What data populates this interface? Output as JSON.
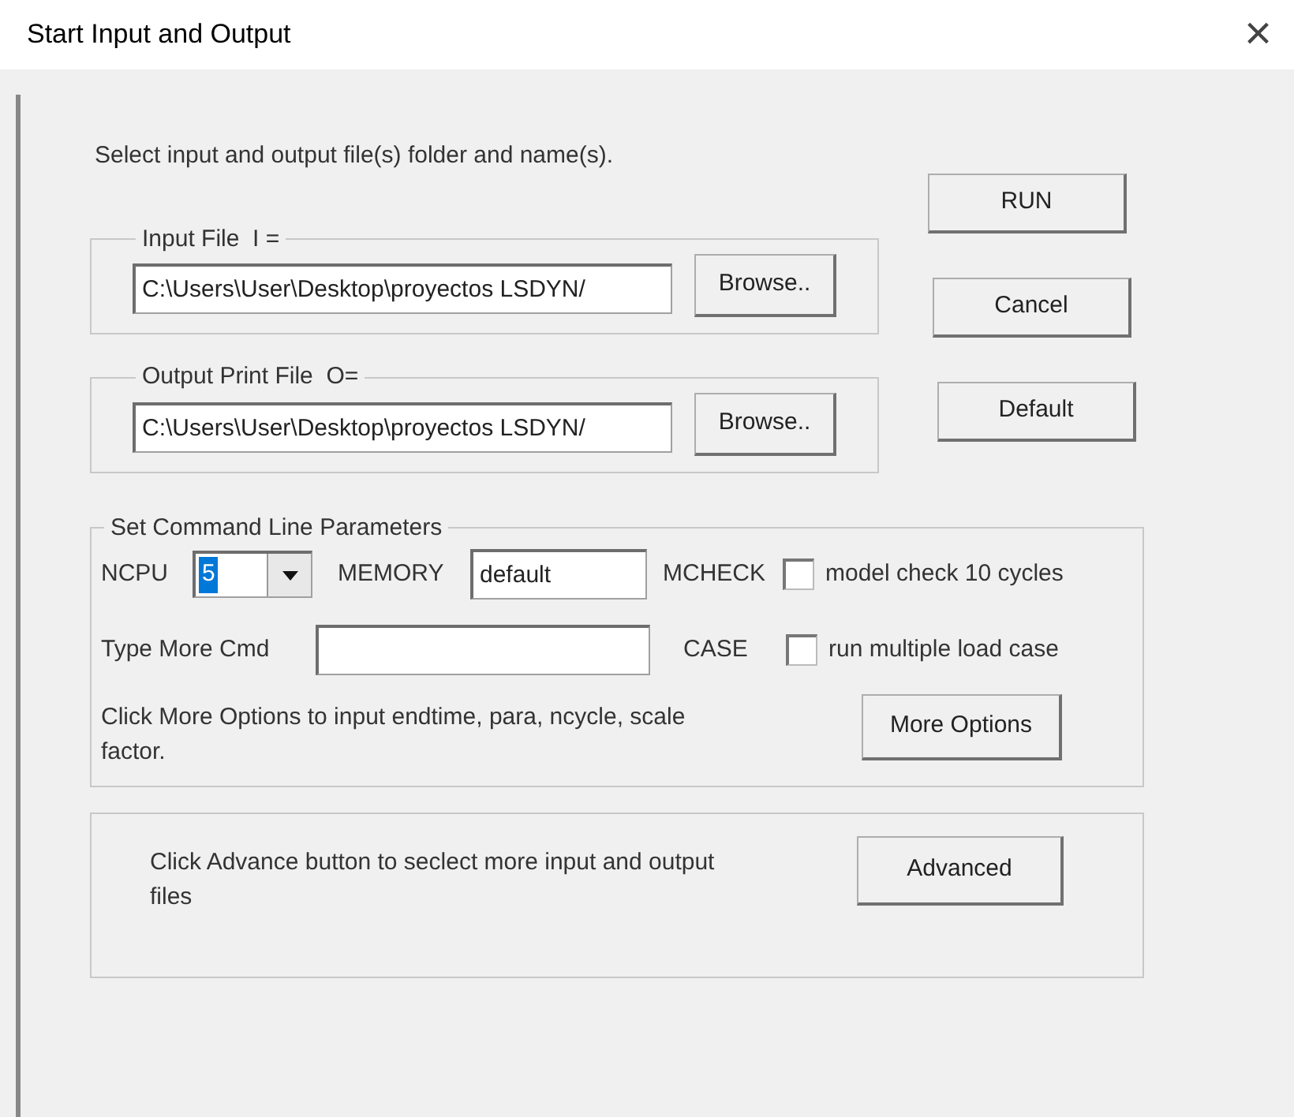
{
  "window": {
    "title": "Start Input and Output",
    "close": "×"
  },
  "intro": "Select input and output file(s) folder and name(s).",
  "input_file": {
    "legend": "Input File  I =",
    "value": "C:\\Users\\User\\Desktop\\proyectos LSDYN/",
    "button": "Browse.."
  },
  "output_file": {
    "legend": "Output Print File  O=",
    "value": "C:\\Users\\User\\Desktop\\proyectos LSDYN/",
    "button": "Browse.."
  },
  "side_buttons": [
    "RUN",
    "Cancel",
    "Default"
  ],
  "parameters": {
    "legend": "Set Command Line Parameters",
    "ncpu": {
      "label": "NCPU",
      "value": "5"
    },
    "memory": {
      "label": "MEMORY",
      "value": "default"
    },
    "mcheck": {
      "label": "MCHECK",
      "checked": false,
      "text": "model check 10 cycles"
    },
    "more_cmd": {
      "label": "Type More Cmd"
    },
    "case": {
      "label": "CASE",
      "checked": false,
      "text": "run multiple load case"
    },
    "hint": "Click More Options to input endtime, para, ncycle, scale factor.",
    "button": "More Options"
  },
  "advanced": {
    "text": "Click Advance button to seclect more input and output files",
    "button": "Advanced"
  }
}
